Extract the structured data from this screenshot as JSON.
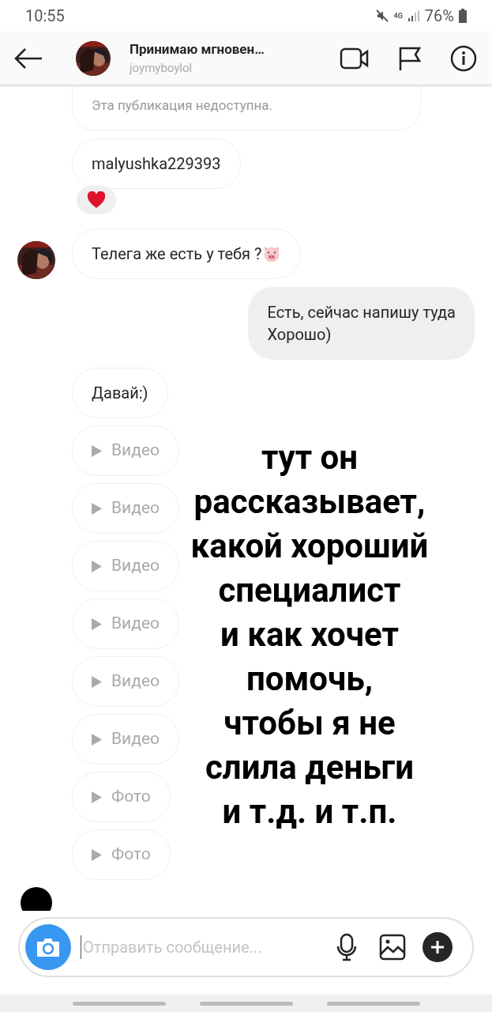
{
  "status_bar": {
    "time": "10:55",
    "network": "4G",
    "battery": "76%"
  },
  "header": {
    "title": "Принимаю мгновен…",
    "subtitle": "joymyboylol"
  },
  "messages": [
    {
      "kind": "post_unavailable",
      "text": "Эта публикация недоступна."
    },
    {
      "kind": "incoming",
      "text": "malyushka229393",
      "avatar": false,
      "pig_emoji": false
    },
    {
      "kind": "reaction"
    },
    {
      "kind": "incoming",
      "text": "Телега же есть у тебя ?",
      "avatar": true,
      "pig_emoji": true
    },
    {
      "kind": "outgoing",
      "text": "Есть, сейчас напишу туда\nХорошо)"
    },
    {
      "kind": "incoming",
      "text": "Давай:)",
      "avatar": false,
      "pig_emoji": false
    },
    {
      "kind": "media",
      "text": "Видео"
    },
    {
      "kind": "media",
      "text": "Видео"
    },
    {
      "kind": "media",
      "text": "Видео"
    },
    {
      "kind": "media",
      "text": "Видео"
    },
    {
      "kind": "media",
      "text": "Видео"
    },
    {
      "kind": "media",
      "text": "Видео"
    },
    {
      "kind": "media",
      "text": "Фото"
    },
    {
      "kind": "media",
      "text": "Фото"
    }
  ],
  "overlay_caption": "тут он\nрассказывает,\nкакой хороший\nспециалист\nи как хочет\nпомочь,\nчтобы я не\nслила деньги\nи т.д. и т.п.",
  "composer": {
    "placeholder": "Отправить сообщение..."
  }
}
